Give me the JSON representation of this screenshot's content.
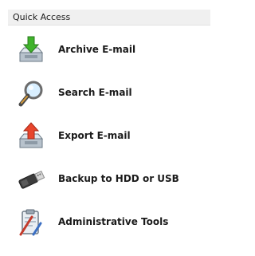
{
  "panel": {
    "title": "Quick Access",
    "items": [
      {
        "label": "Archive E-mail",
        "icon": "archive-icon"
      },
      {
        "label": "Search E-mail",
        "icon": "magnifier-icon"
      },
      {
        "label": "Export E-mail",
        "icon": "export-icon"
      },
      {
        "label": "Backup to HDD or USB",
        "icon": "usb-drive-icon"
      },
      {
        "label": "Administrative Tools",
        "icon": "clipboard-tools-icon"
      }
    ]
  }
}
